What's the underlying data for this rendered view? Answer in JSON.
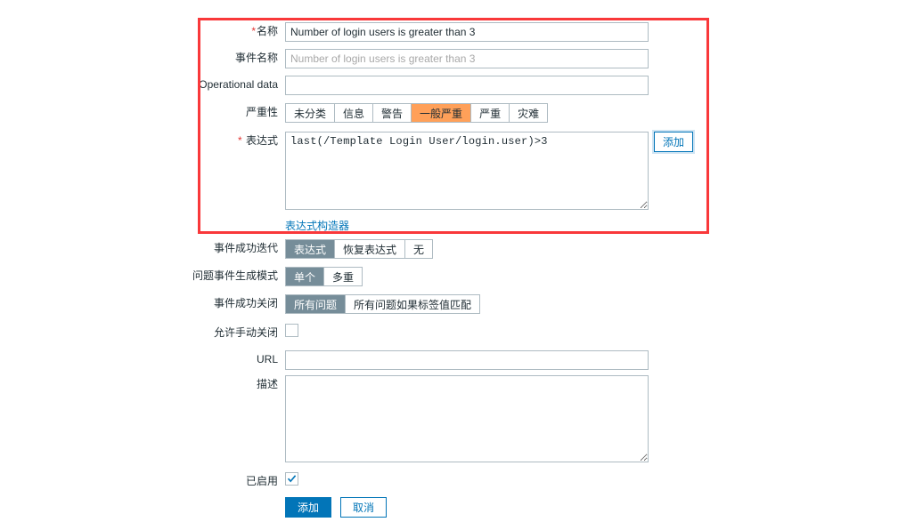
{
  "highlight": {
    "color": "#f9383a"
  },
  "form": {
    "name": {
      "label": "名称",
      "required": "*",
      "value": "Number of login users is greater than 3"
    },
    "event_name": {
      "label": "事件名称",
      "value": "",
      "placeholder": "Number of login users is greater than 3"
    },
    "operational_data": {
      "label": "Operational data",
      "value": "",
      "placeholder": ""
    },
    "severity": {
      "label": "严重性",
      "options": [
        "未分类",
        "信息",
        "警告",
        "一般严重",
        "严重",
        "灾难"
      ],
      "selected_index": 3,
      "selected_color": "#ffa059"
    },
    "expression": {
      "label": "表达式",
      "required": "*",
      "value": "last(/Template Login User/login.user)>3",
      "add_button": "添加",
      "constructor_link": "表达式构造器"
    },
    "ok_event_generation": {
      "label": "事件成功迭代",
      "options": [
        "表达式",
        "恢复表达式",
        "无"
      ],
      "selected_index": 0,
      "selected_color": "#768d99"
    },
    "problem_event_generation_mode": {
      "label": "问题事件生成模式",
      "options": [
        "单个",
        "多重"
      ],
      "selected_index": 0,
      "selected_color": "#768d99"
    },
    "ok_event_closes": {
      "label": "事件成功关闭",
      "options": [
        "所有问题",
        "所有问题如果标签值匹配"
      ],
      "selected_index": 0,
      "selected_color": "#768d99"
    },
    "allow_manual_close": {
      "label": "允许手动关闭",
      "checked": false
    },
    "url": {
      "label": "URL",
      "value": "",
      "placeholder": ""
    },
    "description": {
      "label": "描述",
      "value": "",
      "placeholder": ""
    },
    "enabled": {
      "label": "已启用",
      "checked": true
    }
  },
  "footer": {
    "submit": "添加",
    "cancel": "取消"
  }
}
